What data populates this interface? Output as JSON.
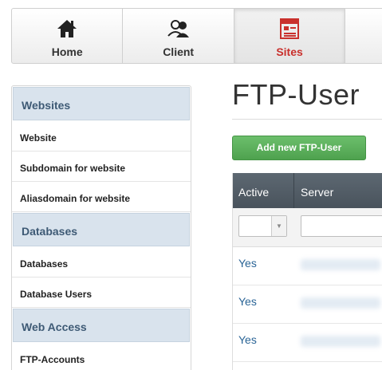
{
  "topnav": {
    "tabs": [
      {
        "label": "Home",
        "icon": "home-icon"
      },
      {
        "label": "Client",
        "icon": "users-icon"
      },
      {
        "label": "Sites",
        "icon": "sites-icon"
      }
    ],
    "active_tab": "Sites",
    "active_color": "#c9302c"
  },
  "sidebar": {
    "sections": [
      {
        "title": "Websites",
        "items": [
          "Website",
          "Subdomain for website",
          "Aliasdomain for website"
        ]
      },
      {
        "title": "Databases",
        "items": [
          "Databases",
          "Database Users"
        ]
      },
      {
        "title": "Web Access",
        "items": [
          "FTP-Accounts"
        ]
      }
    ]
  },
  "main": {
    "title": "FTP-User",
    "add_button": "Add new FTP-User",
    "grid": {
      "columns": [
        "Active",
        "Server"
      ],
      "rows": [
        {
          "active": "Yes"
        },
        {
          "active": "Yes"
        },
        {
          "active": "Yes"
        }
      ]
    }
  },
  "colors": {
    "button_green": "#5cb85c",
    "sidebar_header": "#d9e3ed",
    "grid_header": "#525c65",
    "link": "#2a6496"
  }
}
